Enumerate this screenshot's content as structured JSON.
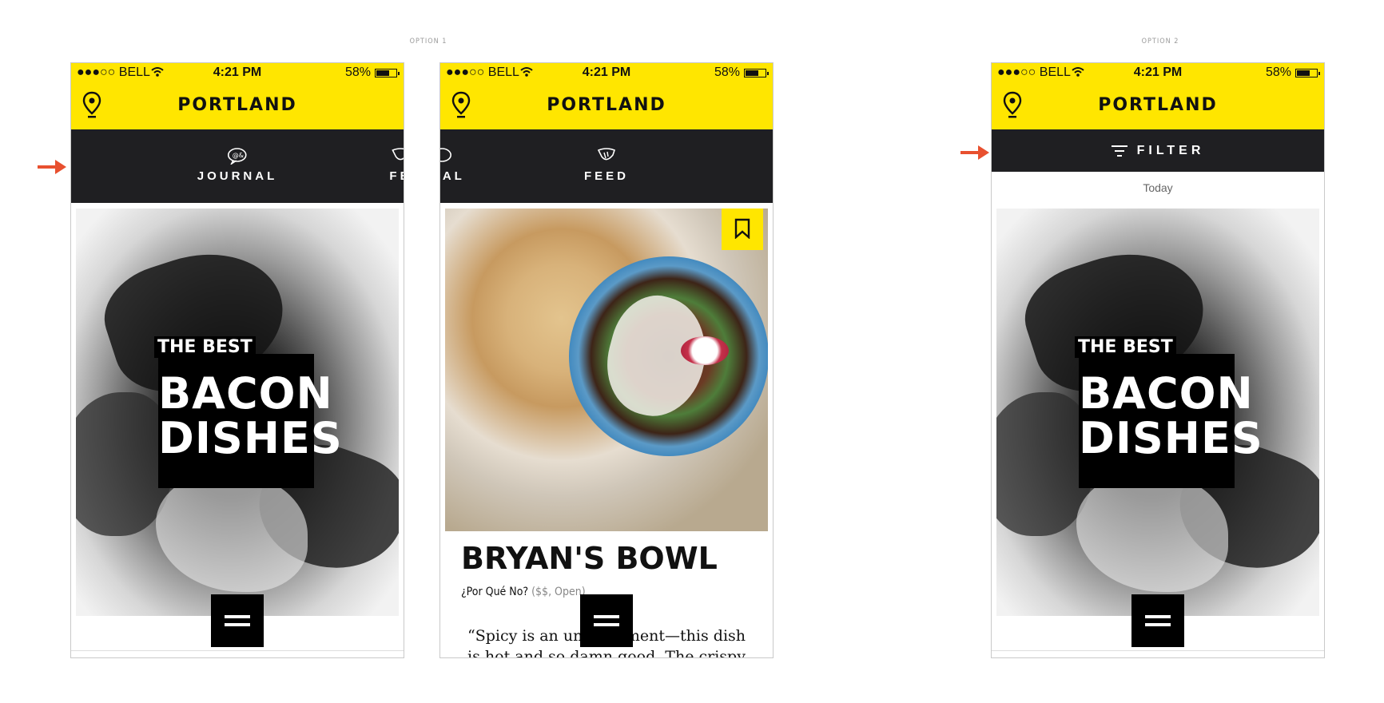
{
  "labels": {
    "option1": "OPTION 1",
    "option2": "OPTION 2"
  },
  "status": {
    "carrier": "●●●○○ BELL",
    "time": "4:21 PM",
    "battery": "58%"
  },
  "city": "PORTLAND",
  "phone1": {
    "tabs": [
      "JOURNAL",
      "FE"
    ],
    "kicker": "THE BEST",
    "headline": "BACON DISHES"
  },
  "phone2": {
    "tabs": [
      "RNAL",
      "FEED"
    ],
    "title": "BRYAN'S BOWL",
    "place": "¿Por Qué No?",
    "place_meta": "($$, Open)",
    "body": "“Spicy is an un… element—this dish is hot and so damn good. The crispy"
  },
  "phone3": {
    "filter_label": "FILTER",
    "section": "Today",
    "kicker": "THE BEST",
    "headline": "BACON DISHES"
  },
  "colors": {
    "accent": "#ffe600",
    "nav": "#1f1f22",
    "arrow": "#e8502f"
  },
  "icons": [
    "location-pin-icon",
    "journal-icon",
    "feed-icon",
    "bookmark-icon",
    "filter-icon",
    "menu-icon",
    "wifi-icon",
    "battery-icon",
    "arrow-right-icon"
  ]
}
